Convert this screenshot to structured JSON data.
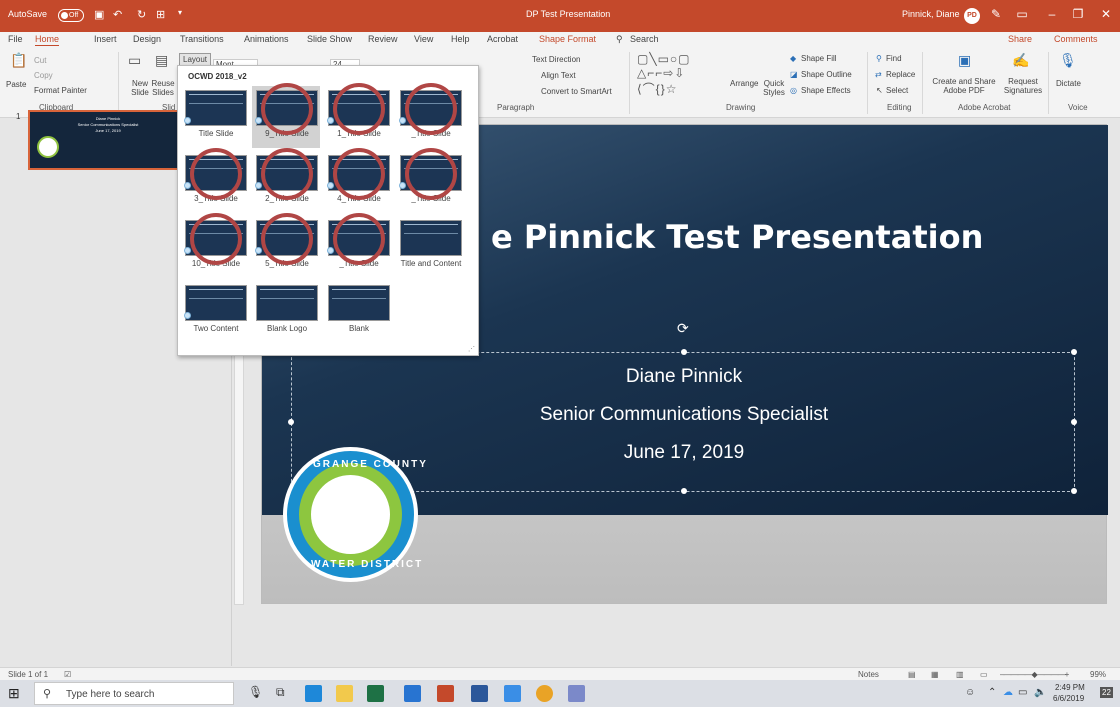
{
  "titlebar": {
    "autosave": "AutoSave",
    "toggle": "Off",
    "doc_title": "DP Test Presentation",
    "user": "Pinnick, Diane",
    "initials": "PD"
  },
  "tabs": [
    "File",
    "Home",
    "Insert",
    "Design",
    "Transitions",
    "Animations",
    "Slide Show",
    "Review",
    "View",
    "Help",
    "Acrobat",
    "Shape Format"
  ],
  "search_label": "Search",
  "share": "Share",
  "comments": "Comments",
  "ribbon": {
    "cut": "Cut",
    "copy": "Copy",
    "paste": "Paste",
    "format_painter": "Format Painter",
    "new_slide": "New Slide",
    "reuse_slides": "Reuse Slides",
    "layout": "Layout",
    "font": "Mont",
    "size": "24",
    "text_direction": "Text Direction",
    "align_text": "Align Text",
    "convert_smartart": "Convert to SmartArt",
    "arrange": "Arrange",
    "quick_styles": "Quick Styles",
    "shape_fill": "Shape Fill",
    "shape_outline": "Shape Outline",
    "shape_effects": "Shape Effects",
    "find": "Find",
    "replace": "Replace",
    "select": "Select",
    "create_share": "Create and Share Adobe PDF",
    "request_sig": "Request Signatures",
    "dictate": "Dictate",
    "groups": {
      "clipboard": "Clipboard",
      "slides": "Slid",
      "paragraph": "Paragraph",
      "drawing": "Drawing",
      "editing": "Editing",
      "adobe": "Adobe Acrobat",
      "voice": "Voice"
    }
  },
  "thumb": {
    "number": "1",
    "name": "Diane Pinnick",
    "role": "Senior Communications Specialist",
    "date": "June 17, 2019"
  },
  "gallery": {
    "title": "OCWD 2018_v2",
    "layouts": [
      "Title Slide",
      "9_Title Slide",
      "1_Title Slide",
      "_Title Slide",
      "3_Title Slide",
      "2_Title Slide",
      "4_Title Slide",
      "_Title Slide",
      "10_Title Slide",
      "5_Title Slide",
      "_Title Slide",
      "Title and Content",
      "Two Content",
      "Blank Logo",
      "Blank"
    ]
  },
  "slide": {
    "title": "e Pinnick Test Presentation",
    "line1": "Diane Pinnick",
    "line2": "Senior Communications Specialist",
    "line3": "June 17, 2019",
    "logo_top": "GRANGE COUNTY",
    "logo_bottom": "WATER DISTRICT"
  },
  "status": {
    "slide_of": "Slide 1 of 1",
    "notes": "Notes",
    "zoom": "99%"
  },
  "taskbar": {
    "search_placeholder": "Type here to search",
    "time": "2:49 PM",
    "date": "6/6/2019",
    "notif": "22"
  },
  "colors": {
    "accent": "#c4492b",
    "highlight_circle": "#b04645"
  }
}
